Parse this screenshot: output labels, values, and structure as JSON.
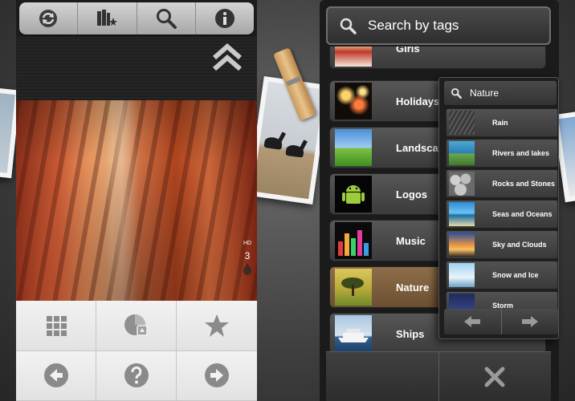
{
  "left_app": {
    "toolbar": {
      "buttons": [
        {
          "name": "refresh",
          "icon": "refresh-icon"
        },
        {
          "name": "categories",
          "icon": "books-star-icon"
        },
        {
          "name": "search",
          "icon": "search-icon"
        },
        {
          "name": "info",
          "icon": "info-icon"
        }
      ]
    },
    "scroll_up_icon": "double-chevron-up-icon",
    "photo": {
      "hd_label": "HD",
      "hd_count": "3"
    },
    "bottom_buttons": [
      {
        "name": "grid",
        "icon": "grid-icon"
      },
      {
        "name": "set-wallpaper",
        "icon": "wallpaper-icon"
      },
      {
        "name": "favorite",
        "icon": "star-icon"
      },
      {
        "name": "previous",
        "icon": "arrow-left-icon"
      },
      {
        "name": "help",
        "icon": "question-icon"
      },
      {
        "name": "next",
        "icon": "arrow-right-icon"
      }
    ]
  },
  "right_app": {
    "header": {
      "title": "Search by tags",
      "icon": "search-icon"
    },
    "tags": [
      {
        "label": "Girls",
        "thumb": "girl"
      },
      {
        "label": "Holidays",
        "thumb": "fireworks"
      },
      {
        "label": "Landscapes",
        "thumb": "field"
      },
      {
        "label": "Logos",
        "thumb": "android"
      },
      {
        "label": "Music",
        "thumb": "equalizer"
      },
      {
        "label": "Nature",
        "thumb": "tree",
        "selected": true
      },
      {
        "label": "Ships",
        "thumb": "ship"
      }
    ],
    "footer": {
      "close_icon": "close-x-icon"
    },
    "sub_popup": {
      "header": {
        "title": "Nature",
        "icon": "search-icon"
      },
      "items": [
        {
          "label": "Rain",
          "thumb": "rain"
        },
        {
          "label": "Rivers and lakes",
          "thumb": "river"
        },
        {
          "label": "Rocks and Stones",
          "thumb": "rocks"
        },
        {
          "label": "Seas and Oceans",
          "thumb": "sea"
        },
        {
          "label": "Sky and Clouds",
          "thumb": "sky"
        },
        {
          "label": "Snow and Ice",
          "thumb": "snow"
        },
        {
          "label": "Storm",
          "thumb": "storm"
        }
      ],
      "footer": {
        "back_icon": "arrow-left-icon",
        "next_icon": "arrow-right-icon"
      }
    }
  }
}
